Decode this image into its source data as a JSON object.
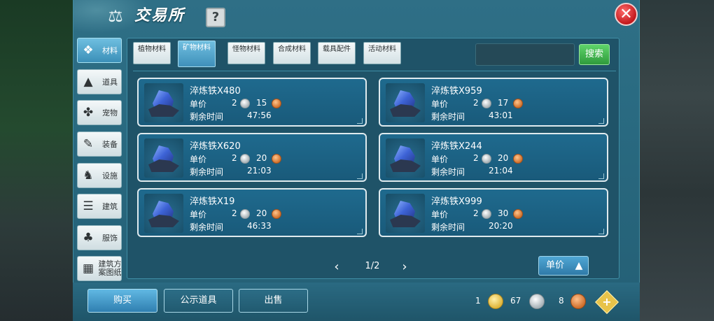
{
  "window": {
    "title": "交易所",
    "help_label": "?",
    "close_label": "✕"
  },
  "sidebar": {
    "items": [
      {
        "label": "材料",
        "icon": "materials-icon",
        "active": true
      },
      {
        "label": "道具",
        "icon": "flask-icon",
        "active": false
      },
      {
        "label": "宠物",
        "icon": "paw-icon",
        "active": false
      },
      {
        "label": "装备",
        "icon": "armor-icon",
        "active": false
      },
      {
        "label": "设施",
        "icon": "facility-icon",
        "active": false
      },
      {
        "label": "建筑",
        "icon": "building-icon",
        "active": false
      },
      {
        "label": "服饰",
        "icon": "clothing-icon",
        "active": false
      },
      {
        "label": "建筑方案图纸",
        "icon": "blueprint-icon",
        "active": false
      }
    ]
  },
  "tabs": [
    {
      "label": "植物材料",
      "active": false
    },
    {
      "label": "矿物材料",
      "active": true
    },
    {
      "label": "怪物材料",
      "active": false
    },
    {
      "label": "合成材料",
      "active": false
    },
    {
      "label": "载具配件",
      "active": false
    },
    {
      "label": "活动材料",
      "active": false
    }
  ],
  "search": {
    "placeholder": "",
    "button_label": "搜索"
  },
  "listing_labels": {
    "price": "单价",
    "time_left": "剩余时间"
  },
  "listings": [
    {
      "name": "淬炼铁X480",
      "silver": "2",
      "copper": "15",
      "time": "47:56"
    },
    {
      "name": "淬炼铁X959",
      "silver": "2",
      "copper": "17",
      "time": "43:01"
    },
    {
      "name": "淬炼铁X620",
      "silver": "2",
      "copper": "20",
      "time": "21:03"
    },
    {
      "name": "淬炼铁X244",
      "silver": "2",
      "copper": "20",
      "time": "21:04"
    },
    {
      "name": "淬炼铁X19",
      "silver": "2",
      "copper": "20",
      "time": "46:33"
    },
    {
      "name": "淬炼铁X999",
      "silver": "2",
      "copper": "30",
      "time": "20:20"
    }
  ],
  "pager": {
    "text": "1/2",
    "prev": "‹",
    "next": "›"
  },
  "sort": {
    "label": "单价",
    "icon": "▲"
  },
  "bottom": {
    "buy_label": "购买",
    "public_label": "公示道具",
    "sell_label": "出售"
  },
  "currency": {
    "gold": "1",
    "silver": "67",
    "copper": "8",
    "add_label": "+"
  },
  "colors": {
    "window_bg": "#2a6b82",
    "card_bg": "#1f6a8e",
    "search_button": "#3fb04c",
    "close_button": "#d6262a"
  }
}
